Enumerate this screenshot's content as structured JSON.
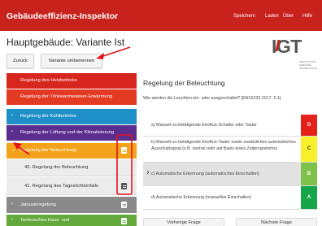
{
  "app": {
    "title": "Gebäudeeffizienz-Inspektor",
    "nav": [
      "Speichern",
      "Laden",
      "Über",
      "Hilfe"
    ],
    "brand_color": "#c8221d"
  },
  "page": {
    "title": "Hauptgebäude: Variante Ist",
    "back_label": "Zurück",
    "rename_label": "Variante umbenennen"
  },
  "logo": {
    "text": "IGT",
    "sub_lines": [
      "INSTITUT FÜR",
      "GEBÄUDE-",
      "TECHNOLOGIE"
    ]
  },
  "sidebar": {
    "items": [
      {
        "label": "Regelung des Heizbetriebs",
        "color": "#d7261e",
        "icon": ""
      },
      {
        "label": "Regelung der Trinkwarmwasser-Erwärmung",
        "color": "#e33a24",
        "icon": ""
      },
      {
        "label": "Regelung der Kühlbetriebs",
        "color": "#1f8fc7",
        "icon": "chevron-right-icon"
      },
      {
        "label": "Regelung der Lüftung und der Klimatisierung",
        "color": "#5b2d8e",
        "icon": "chevron-right-icon"
      },
      {
        "label": "Regelung der Beleuchtung",
        "color": "#f2a31b",
        "icon": "chevron-down-icon"
      }
    ],
    "subitems": [
      {
        "label": "40. Regelung der Beleuchtung"
      },
      {
        "label": "41. Regelung des Tageslichteinfalls"
      }
    ],
    "lower": [
      {
        "label": "Jalousieregelung",
        "color": "#8a8a8a",
        "icon": "chevron-right-icon"
      },
      {
        "label": "Technisches Haus- und",
        "color": "#62a83b",
        "icon": "chevron-right-icon"
      }
    ]
  },
  "main": {
    "heading": "Regelung der Beleuchtung",
    "question": "Wie werden die Leuchten ein- oder ausgeschaltet? [EN15232:2017; 5.1]",
    "options": [
      {
        "text": "a) Manuell zu betätigende Ein/Aus-Schalter oder Taster",
        "tag": "D",
        "tag_color": "#e32119",
        "tag_text_color": "#ffffff"
      },
      {
        "text": "b) Manuell zu betätigende Ein/Aus-Taster sowie zusätzliches automatisches Ausschaltsignal (z.B. zentral oder auf Basis eines Zeitprogramms)",
        "tag": "C",
        "tag_color": "#f6ef2a",
        "tag_text_color": "#333333"
      },
      {
        "text": "c) Automatische Erkennung (automatisches Einschalten)",
        "tag": "B",
        "tag_color": "#7dc14b",
        "tag_text_color": "#ffffff"
      },
      {
        "text": "d) Automatische Erkennung (manuelles Einschalten)",
        "tag": "A",
        "tag_color": "#16a64a",
        "tag_text_color": "#ffffff"
      }
    ],
    "prev_label": "Vorherige Frage",
    "next_label": "Nächste Frage"
  },
  "annotation_color": "#e3141b"
}
